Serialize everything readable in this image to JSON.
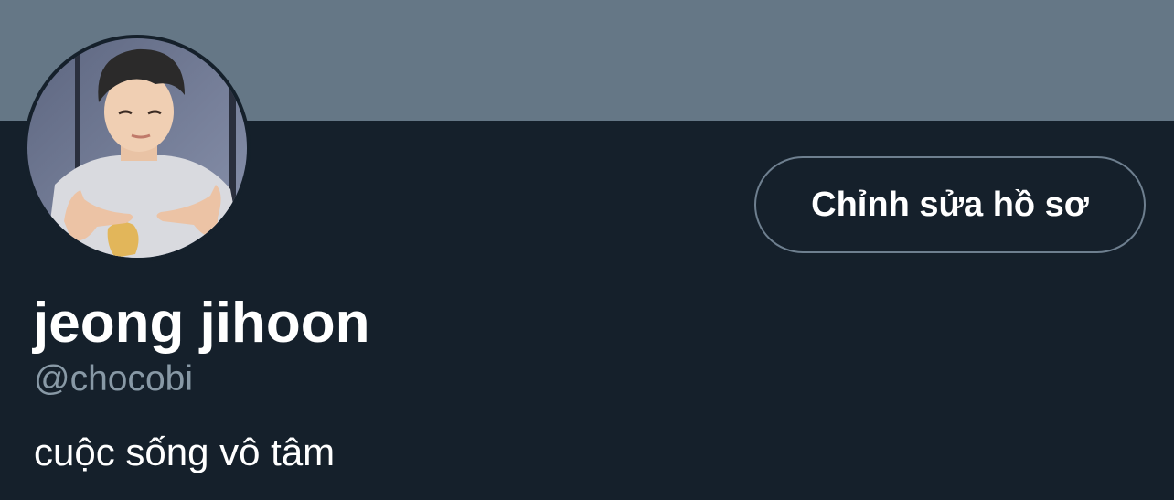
{
  "profile": {
    "display_name": "jeong jihoon",
    "handle": "@chocobi",
    "bio": "cuộc sống vô tâm",
    "edit_button_label": "Chỉnh sửa hồ sơ",
    "avatar_icon": "profile-photo"
  },
  "colors": {
    "banner": "#657786",
    "background": "#15202b",
    "text_primary": "#ffffff",
    "text_secondary": "#8899a6",
    "button_border": "#6e7f8f"
  }
}
